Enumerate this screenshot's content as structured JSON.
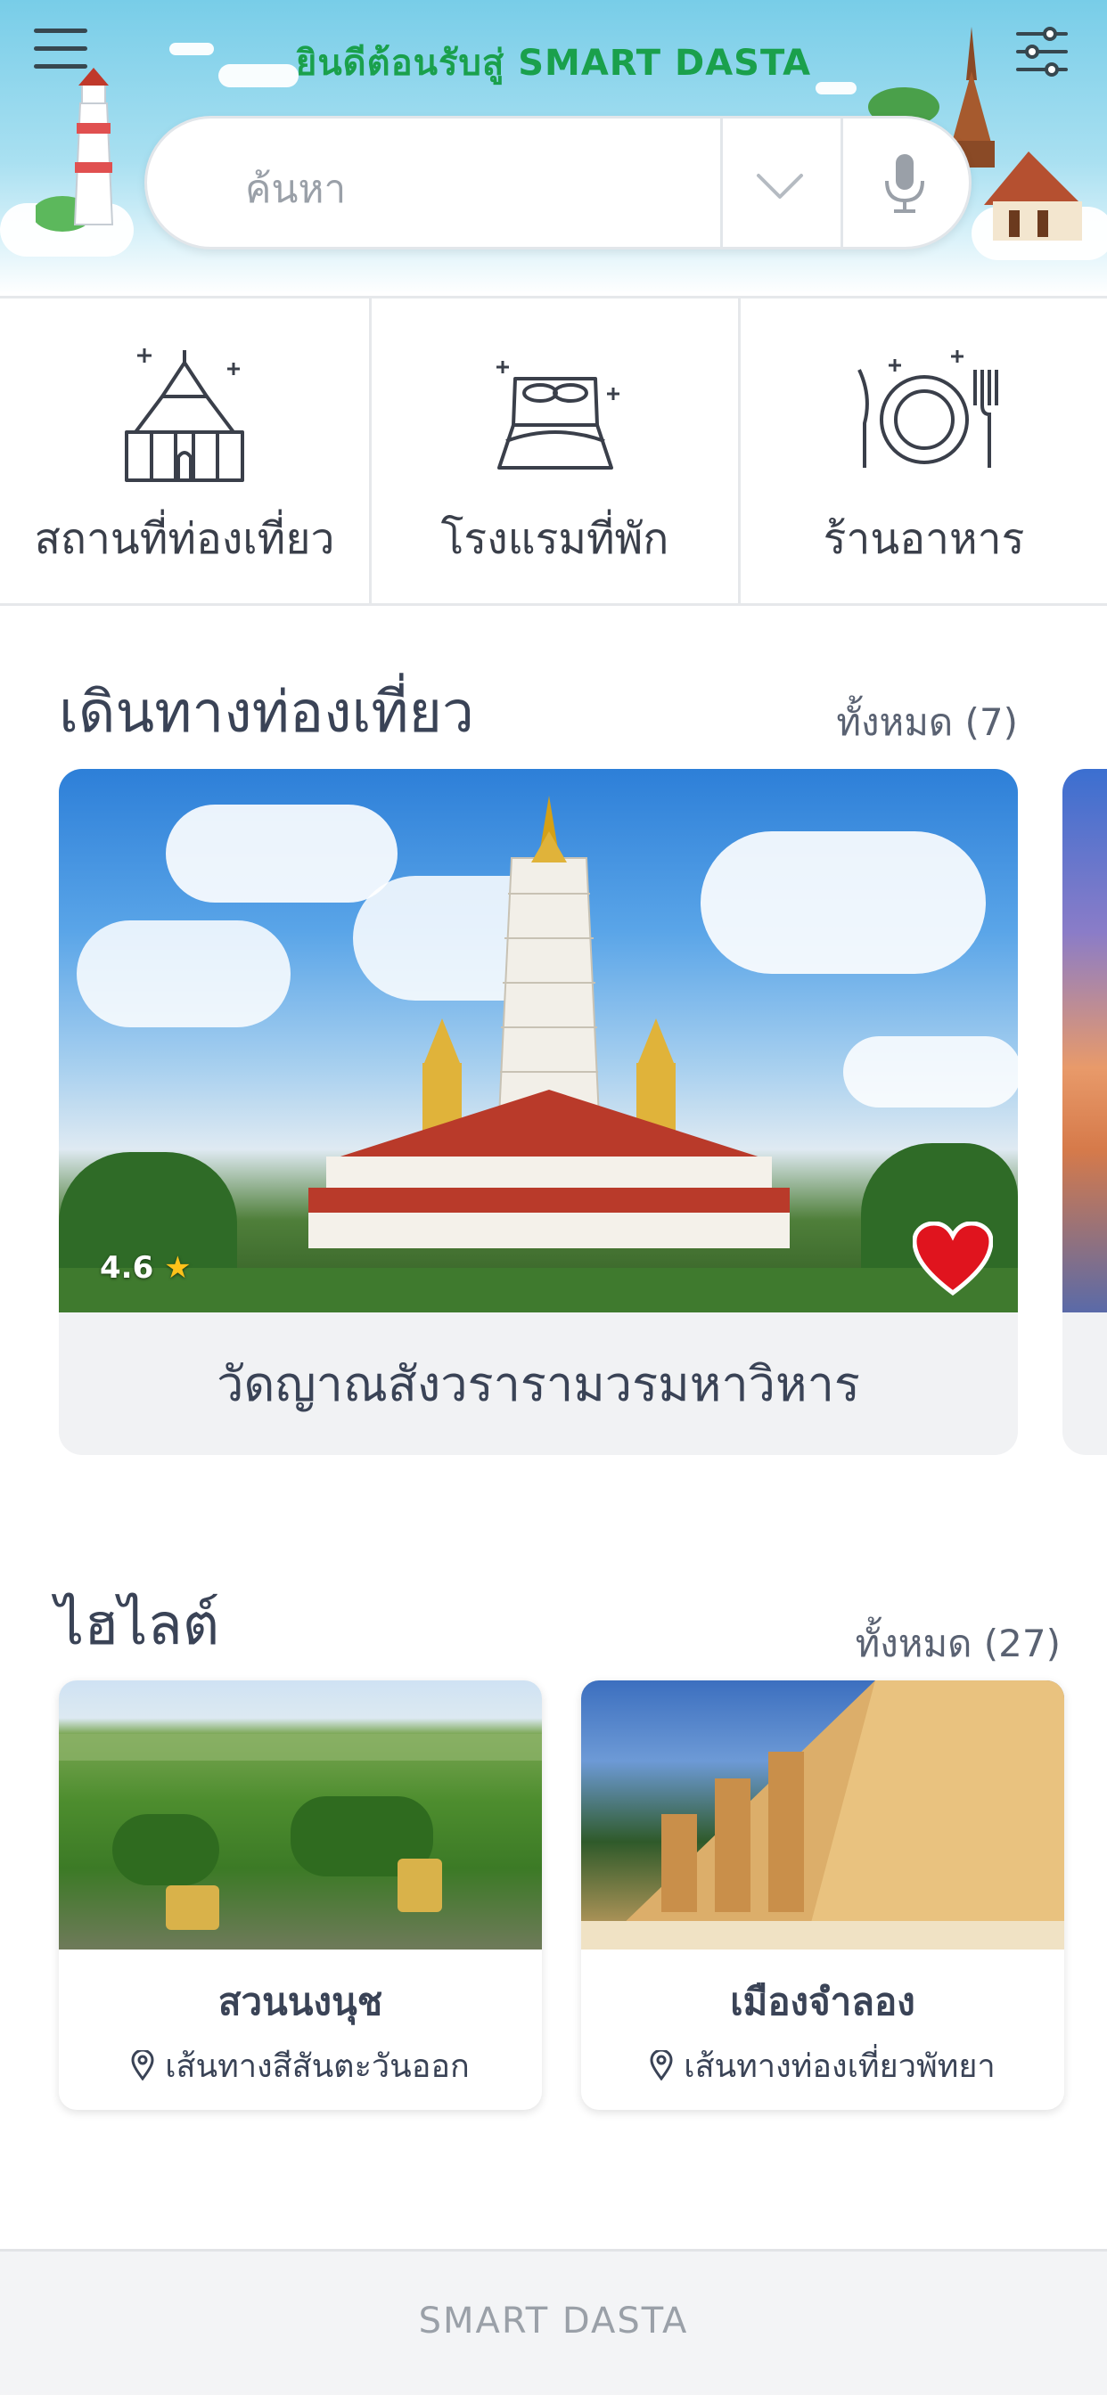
{
  "header": {
    "welcome": "ยินดีต้อนรับสู่ SMART DASTA",
    "menu_icon": "hamburger-icon",
    "filter_icon": "sliders-icon"
  },
  "search": {
    "placeholder": "ค้นหา",
    "dropdown_icon": "chevron-down-icon",
    "mic_icon": "microphone-icon"
  },
  "categories": [
    {
      "label": "สถานที่ท่องเที่ยว",
      "icon": "temple-icon"
    },
    {
      "label": "โรงแรมที่พัก",
      "icon": "bed-icon"
    },
    {
      "label": "ร้านอาหาร",
      "icon": "plate-cutlery-icon"
    }
  ],
  "trips": {
    "title": "เดินทางท่องเที่ยว",
    "see_all": "ทั้งหมด (7)",
    "featured": {
      "name": "วัดญาณสังวรารามวรมหาวิหาร",
      "rating": "4.6",
      "favorited": true
    }
  },
  "highlights": {
    "title": "ไฮไลต์",
    "see_all": "ทั้งหมด (27)",
    "items": [
      {
        "name": "สวนนงนุช",
        "route": "เส้นทางสีสันตะวันออก"
      },
      {
        "name": "เมืองจำลอง",
        "route": "เส้นทางท่องเที่ยวพัทยา"
      }
    ]
  },
  "footer": {
    "brand": "SMART DASTA"
  },
  "colors": {
    "accent_green": "#1aa04c",
    "heart_red": "#e0141e",
    "star_yellow": "#ffc21a"
  }
}
